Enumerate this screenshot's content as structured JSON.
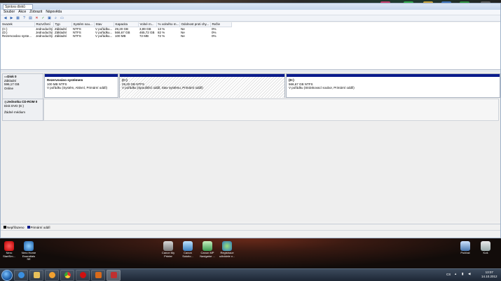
{
  "window": {
    "title": "Správa disků"
  },
  "menu": [
    "Soubor",
    "Akce",
    "Zobrazit",
    "Nápověda"
  ],
  "volume_table": {
    "headers": [
      "Svazek",
      "Rozvržení",
      "Typ",
      "Systém sou...",
      "Stav",
      "Kapacita",
      "Volné m...",
      "% volného m...",
      "Odolnost proti chy...",
      "Režie"
    ],
    "rows": [
      [
        "(C:)",
        "Jednoduchý",
        "Základní",
        "NTFS",
        "V pořádku...",
        "29,20 GB",
        "3,89 GB",
        "13 %",
        "Ne",
        "0%"
      ],
      [
        "(D:)",
        "Jednoduchý",
        "Základní",
        "NTFS",
        "V pořádku...",
        "566,67 GB",
        "465,72 GB",
        "82 %",
        "Ne",
        "0%"
      ],
      [
        "Rezervováno syste...",
        "Jednoduchý",
        "Základní",
        "NTFS",
        "V pořádku...",
        "100 MB",
        "72 MB",
        "72 %",
        "Ne",
        "0%"
      ]
    ]
  },
  "disk0": {
    "name": "Disk 0",
    "type": "Základní",
    "size": "596,17 GB",
    "status": "Online",
    "partitions": [
      {
        "title": "Rezervováno systémem",
        "size": "100 MB NTFS",
        "status": "V pořádku (Systém, Aktivní, Primární oddíl)"
      },
      {
        "title": "(C:)",
        "size": "29,20 GB NTFS",
        "status": "V pořádku (Spouštěcí oddíl, Stav systému, Primární oddíl)"
      },
      {
        "title": "(D:)",
        "size": "566,67 GB NTFS",
        "status": "V pořádku (Stránkovací soubor, Primární oddíl)"
      }
    ]
  },
  "cdrom": {
    "name": "Jednotka CD-ROM 0",
    "type": "Disk DVD (E:)",
    "status": "Žádné médium"
  },
  "legend": [
    {
      "label": "Nepřiřazeno",
      "color": "#000000"
    },
    {
      "label": "Primární oddíl",
      "color": "#0a1b8c"
    }
  ],
  "desktop_icons": [
    {
      "label": "Nero StartSm...",
      "icon": "nero-icon"
    },
    {
      "label": "Nero Home Essentials SE",
      "icon": "nero-home-icon"
    },
    {
      "label": "Canon My Printer",
      "icon": "canon-printer-icon"
    },
    {
      "label": "Canon Solutio...",
      "icon": "canon-solution-icon"
    },
    {
      "label": "Canon MP Navigator ...",
      "icon": "canon-navigator-icon"
    },
    {
      "label": "Registrace učividele v...",
      "icon": "registration-icon"
    },
    {
      "label": "Počítač",
      "icon": "computer-icon"
    },
    {
      "label": "Koš",
      "icon": "recycle-bin-icon"
    }
  ],
  "tray": {
    "lang": "CS",
    "time": "13:07",
    "date": "14.10.2012"
  },
  "colors": {
    "primary_partition": "#0a1b8c",
    "titlebar": "#c5d6ec"
  }
}
